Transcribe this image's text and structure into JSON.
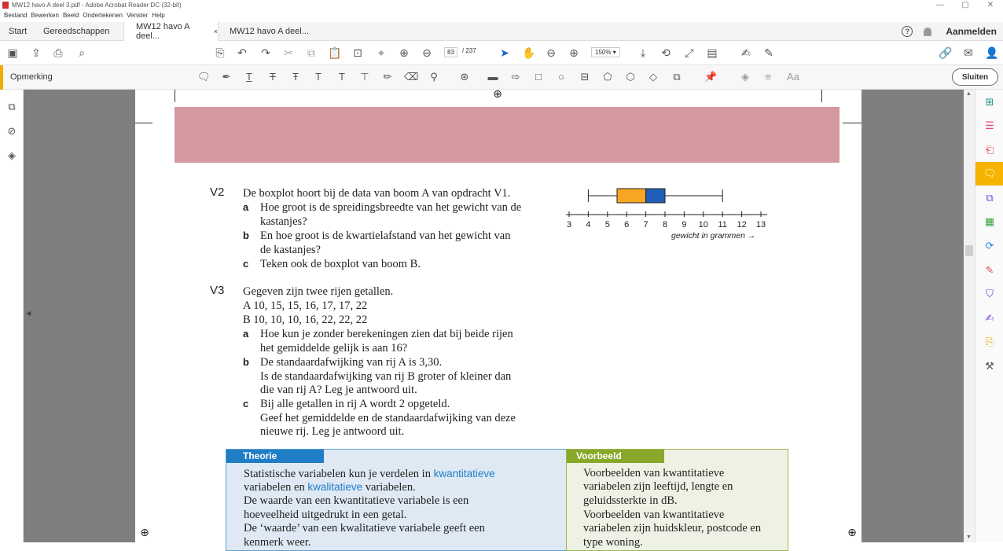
{
  "window": {
    "title": "MW12 havo A deel 3.pdf - Adobe Acrobat Reader DC (32-bit)",
    "controls": [
      "—",
      "▢",
      "✕"
    ]
  },
  "menu": [
    "Bestand",
    "Bewerken",
    "Beeld",
    "Ondertekenen",
    "Venster",
    "Help"
  ],
  "tabs": {
    "start": "Start",
    "tools": "Gereedschappen",
    "doc1": "MW12 havo A deel...",
    "doc1_close": "×",
    "doc2": "MW12 havo A deel...",
    "help": "?",
    "signin": "Aanmelden"
  },
  "toolbar": {
    "page_current": "83",
    "page_total": "/ 237",
    "zoom": "150%"
  },
  "comment_bar": {
    "label": "Opmerking",
    "font_size_label": "Aa",
    "close_label": "Sluiten"
  },
  "colors": {
    "accent": "#f0ad00",
    "theorie": "#1f7dc6",
    "voorbeeld": "#88a82a",
    "pink_band": "#d4989f",
    "box_q1": "#f5a623",
    "box_q3": "#1f5fb8"
  },
  "document": {
    "v2": {
      "num": "V2",
      "intro": "De boxplot hoort bij de data van boom A van opdracht V1.",
      "a_label": "a",
      "a_line1": "Hoe groot is de spreidingsbreedte van het gewicht van de",
      "a_line2": "kastanjes?",
      "b_label": "b",
      "b_line1": "En hoe groot is de kwartielafstand van het gewicht van",
      "b_line2": "de kastanjes?",
      "c_label": "c",
      "c_line1": "Teken ook de boxplot van boom B."
    },
    "boxplot": {
      "ticks": [
        "3",
        "4",
        "5",
        "6",
        "7",
        "8",
        "9",
        "10",
        "11",
        "12",
        "13"
      ],
      "axis_label": "gewicht in grammen →",
      "min": 4,
      "q1": 5.5,
      "median": 7,
      "q3": 8,
      "max": 11
    },
    "v3": {
      "num": "V3",
      "intro": "Gegeven zijn twee rijen getallen.",
      "rowA": "A  10, 15, 15, 16, 17, 17, 22",
      "rowB": "B  10, 10, 10, 16, 22, 22, 22",
      "a_label": "a",
      "a_line1": "Hoe kun je zonder berekeningen zien dat bij beide rijen",
      "a_line2": "het gemiddelde gelijk is aan 16?",
      "b_label": "b",
      "b_line1": "De standaardafwijking van rij A is 3,30.",
      "b_line2": "Is de standaardafwijking van rij B groter of kleiner dan",
      "b_line3": "die van rij A? Leg je antwoord uit.",
      "c_label": "c",
      "c_line1": "Bij alle getallen in rij A wordt 2 opgeteld.",
      "c_line2": "Geef het gemiddelde en de standaardafwijking van deze",
      "c_line3": "nieuwe rij. Leg je antwoord uit."
    },
    "theorie": {
      "title": "Theorie",
      "l1a": "Statistische variabelen kun je verdelen in ",
      "l1b": "kwantitatieve",
      "l2a": "variabelen en ",
      "l2b": "kwalitatieve",
      "l2c": " variabelen.",
      "l3": "De waarde van een kwantitatieve variabele is een",
      "l4": "hoeveelheid uitgedrukt in een getal.",
      "l5": "De ‘waarde’ van een kwalitatieve variabele geeft een",
      "l6": "kenmerk weer."
    },
    "voorbeeld": {
      "title": "Voorbeeld",
      "l1": "Voorbeelden van kwantitatieve",
      "l2": "variabelen zijn leeftijd, lengte en",
      "l3": "geluidssterkte in dB.",
      "l4": "Voorbeelden van kwantitatieve",
      "l5": "variabelen zijn huidskleur, postcode en",
      "l6": "type woning."
    }
  }
}
